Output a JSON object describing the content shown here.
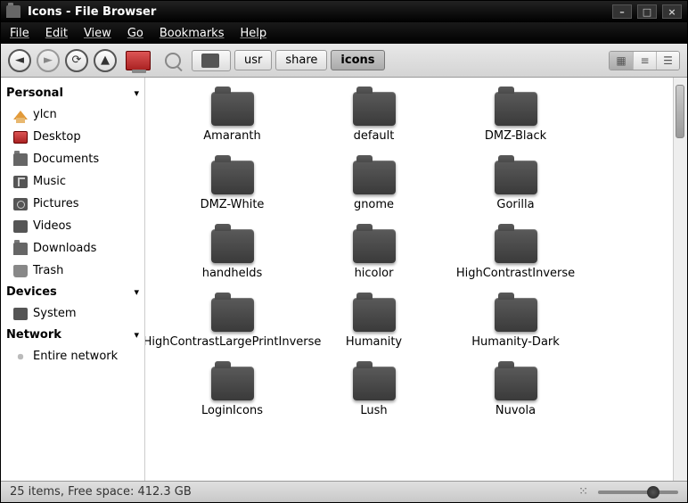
{
  "window": {
    "title": "Icons - File Browser"
  },
  "menu": {
    "file": "File",
    "edit": "Edit",
    "view": "View",
    "go": "Go",
    "bookmarks": "Bookmarks",
    "help": "Help"
  },
  "breadcrumbs": {
    "usr": "usr",
    "share": "share",
    "icons": "icons"
  },
  "sidebar": {
    "sections": {
      "personal": {
        "title": "Personal",
        "items": [
          {
            "label": "ylcn",
            "icon": "home"
          },
          {
            "label": "Desktop",
            "icon": "desktop"
          },
          {
            "label": "Documents",
            "icon": "folder"
          },
          {
            "label": "Music",
            "icon": "music"
          },
          {
            "label": "Pictures",
            "icon": "cam"
          },
          {
            "label": "Videos",
            "icon": "video"
          },
          {
            "label": "Downloads",
            "icon": "folder"
          },
          {
            "label": "Trash",
            "icon": "trash"
          }
        ]
      },
      "devices": {
        "title": "Devices",
        "items": [
          {
            "label": "System",
            "icon": "disk"
          }
        ]
      },
      "network": {
        "title": "Network",
        "items": [
          {
            "label": "Entire network",
            "icon": "net"
          }
        ]
      }
    }
  },
  "folders": [
    "Amaranth",
    "default",
    "DMZ-Black",
    "DMZ-White",
    "gnome",
    "Gorilla",
    "handhelds",
    "hicolor",
    "HighContrastInverse",
    "HighContrastLargePrintInverse",
    "Humanity",
    "Humanity-Dark",
    "LoginIcons",
    "Lush",
    "Nuvola"
  ],
  "status": {
    "text": "25 items, Free space: 412.3 GB"
  }
}
